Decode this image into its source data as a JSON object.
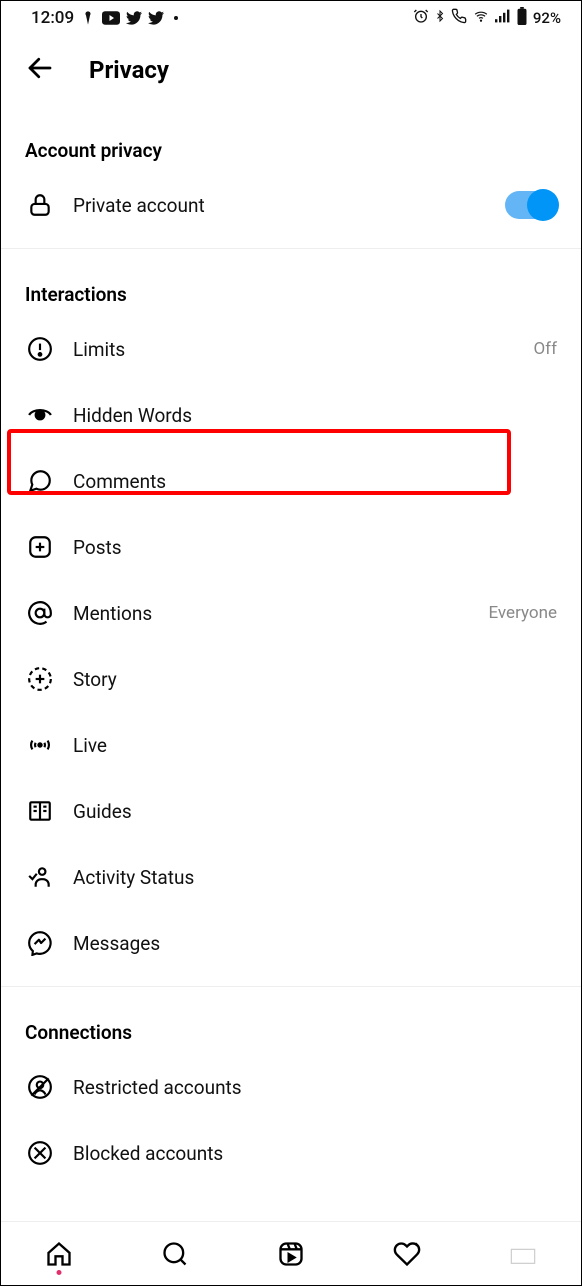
{
  "status": {
    "time": "12:09",
    "battery": "92%"
  },
  "header": {
    "title": "Privacy"
  },
  "sections": {
    "account": {
      "title": "Account privacy",
      "private_label": "Private account"
    },
    "interactions": {
      "title": "Interactions",
      "limits": {
        "label": "Limits",
        "value": "Off"
      },
      "hidden_words": {
        "label": "Hidden Words"
      },
      "comments": {
        "label": "Comments"
      },
      "posts": {
        "label": "Posts"
      },
      "mentions": {
        "label": "Mentions",
        "value": "Everyone"
      },
      "story": {
        "label": "Story"
      },
      "live": {
        "label": "Live"
      },
      "guides": {
        "label": "Guides"
      },
      "activity_status": {
        "label": "Activity Status"
      },
      "messages": {
        "label": "Messages"
      }
    },
    "connections": {
      "title": "Connections",
      "restricted": {
        "label": "Restricted accounts"
      },
      "blocked": {
        "label": "Blocked accounts"
      }
    }
  },
  "highlight": {
    "row": "hidden_words"
  },
  "colors": {
    "accent": "#0095f6",
    "highlight": "#f00"
  }
}
